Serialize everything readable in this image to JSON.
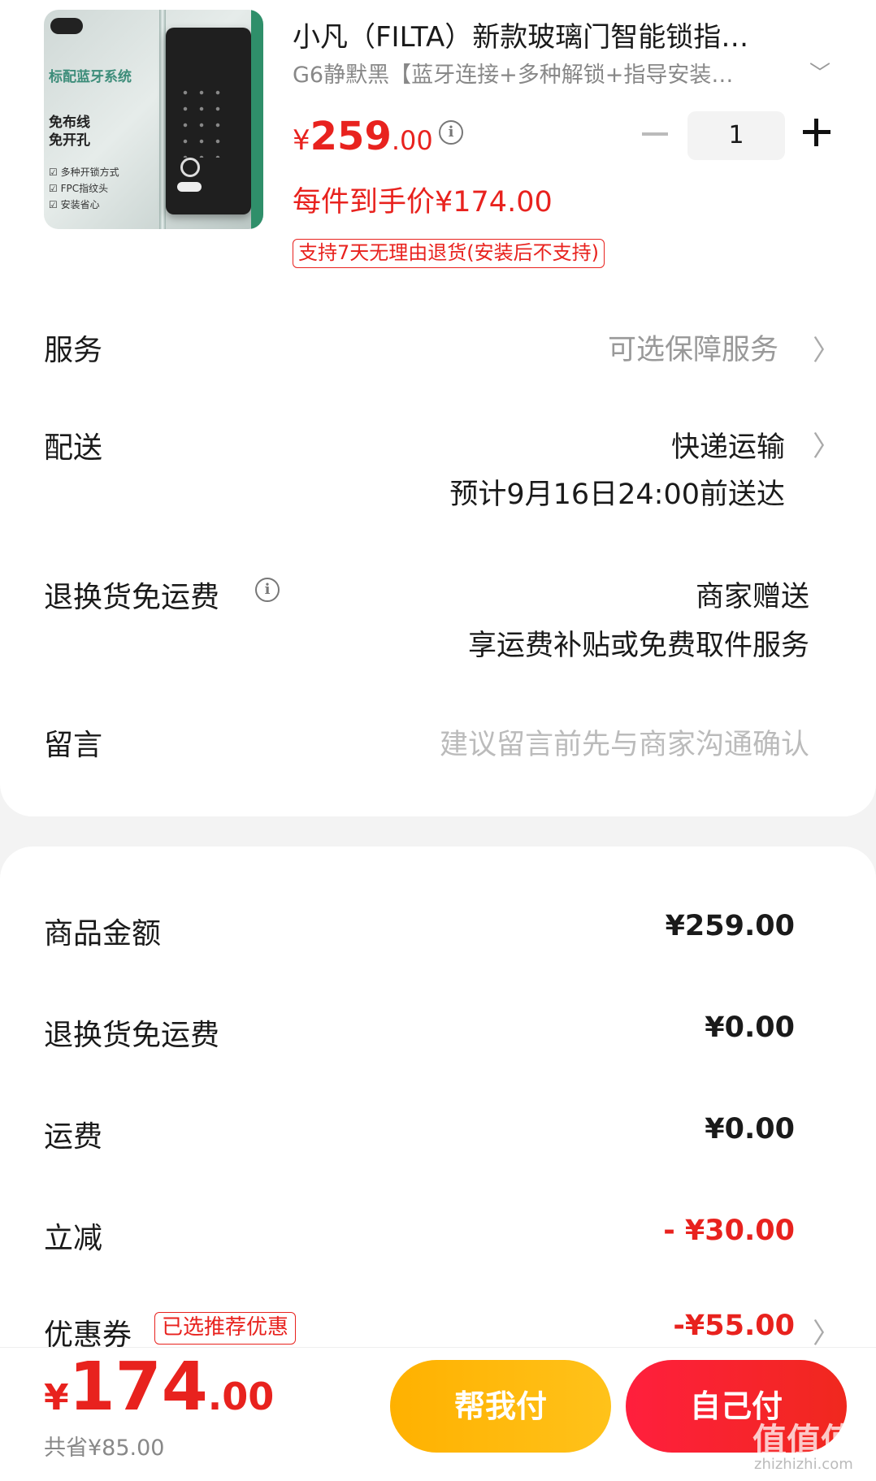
{
  "product": {
    "title": "小凡（FILTA）新款玻璃门智能锁指…",
    "variant": "G6静默黑【蓝牙连接+多种解锁+指导安装…",
    "variant_chevron": "﹀",
    "price_currency": "¥",
    "price_int": "259",
    "price_dec": ".00",
    "quantity": "1",
    "hand_price": "每件到手价¥174.00",
    "return_policy": "支持7天无理由退货(安装后不支持)",
    "image_text": {
      "headline": "标配蓝牙系统",
      "sub": "免布线 免开孔",
      "features": [
        "☑ 多种开锁方式",
        "☑ FPC指纹头",
        "☑ 安装省心"
      ]
    }
  },
  "rows": {
    "service_label": "服务",
    "service_value": "可选保障服务",
    "delivery_label": "配送",
    "delivery_value": "快递运输",
    "delivery_eta": "预计9月16日24:00前送达",
    "return_freight_label": "退换货免运费",
    "return_freight_value": "商家赠送",
    "return_freight_desc": "享运费补贴或免费取件服务",
    "message_label": "留言",
    "message_placeholder": "建议留言前先与商家沟通确认",
    "chevron": "〉",
    "info": "i"
  },
  "summary": {
    "goods_label": "商品金额",
    "goods_value": "¥259.00",
    "return_freight_label": "退换货免运费",
    "return_freight_value": "¥0.00",
    "shipping_label": "运费",
    "shipping_value": "¥0.00",
    "discount_label": "立减",
    "discount_value": "- ¥30.00",
    "coupon_label": "优惠券",
    "coupon_tag": "已选推荐优惠",
    "coupon_value": "-¥55.00"
  },
  "footer": {
    "total_currency": "¥",
    "total_int": "174",
    "total_dec": ".00",
    "saved": "共省¥85.00",
    "help_pay": "帮我付",
    "self_pay": "自己付",
    "watermark": "值值值",
    "watermark_sub": "zhizhizhi.com"
  },
  "colors": {
    "accent_red": "#e8221e",
    "help_button": "#ffb100",
    "self_button": "#ff1f3d"
  }
}
